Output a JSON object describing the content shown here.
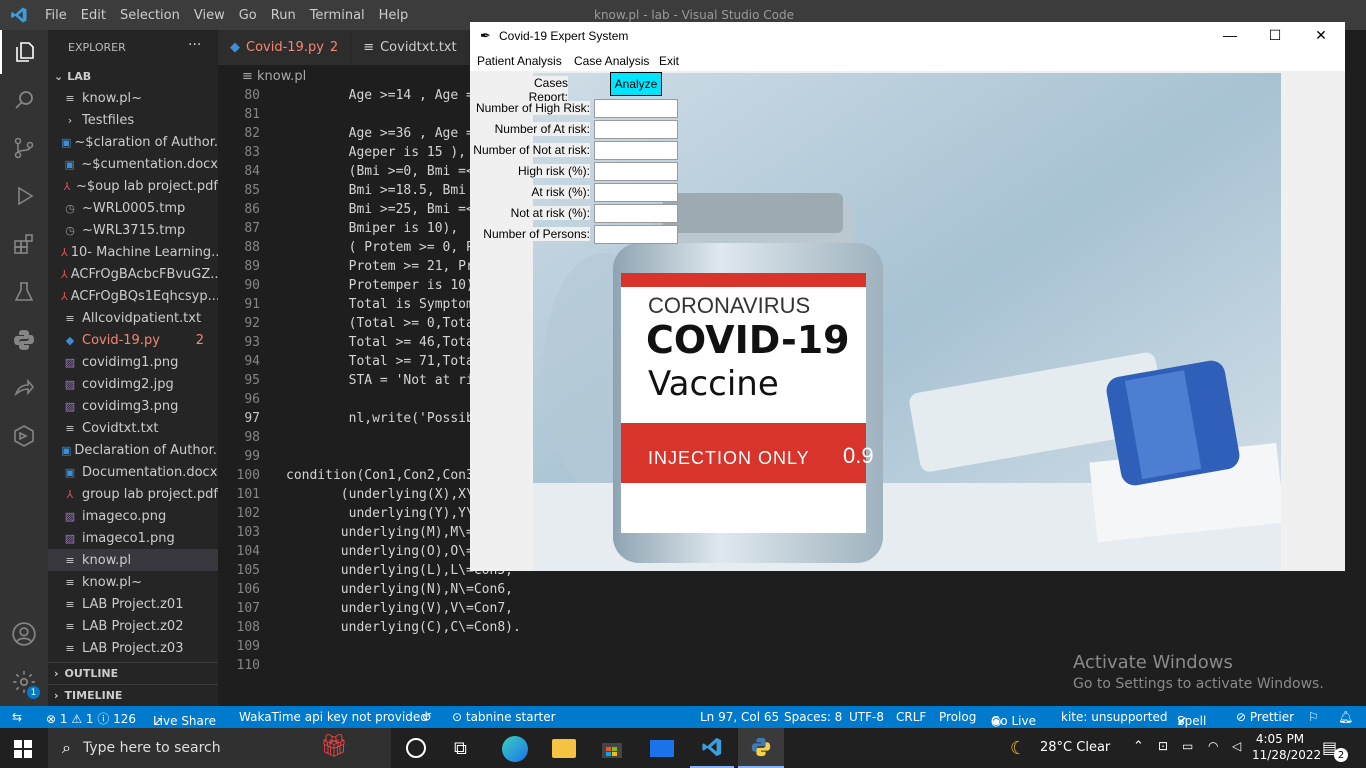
{
  "titlebar": {
    "menu": [
      "File",
      "Edit",
      "Selection",
      "View",
      "Go",
      "Run",
      "Terminal",
      "Help"
    ],
    "window_title": "know.pl - lab - Visual Studio Code"
  },
  "explorer": {
    "header": "EXPLORER",
    "more": "···",
    "folder": "LAB",
    "files": [
      {
        "name": "know.pl~",
        "icon": "≡",
        "color": "#cccccc",
        "badge": ""
      },
      {
        "name": "Testfiles",
        "icon": "›",
        "color": "#cccccc",
        "badge": ""
      },
      {
        "name": "~$claration of Author...",
        "icon": "▣",
        "color": "#3c8fd6",
        "badge": ""
      },
      {
        "name": "~$cumentation.docx",
        "icon": "▣",
        "color": "#3c8fd6",
        "badge": ""
      },
      {
        "name": "~$oup lab project.pdf",
        "icon": "⅄",
        "color": "#e05050",
        "badge": ""
      },
      {
        "name": "~WRL0005.tmp",
        "icon": "◷",
        "color": "#999999",
        "badge": ""
      },
      {
        "name": "~WRL3715.tmp",
        "icon": "◷",
        "color": "#999999",
        "badge": ""
      },
      {
        "name": "10- Machine Learning...",
        "icon": "⅄",
        "color": "#e05050",
        "badge": ""
      },
      {
        "name": "ACFrOgBAcbcFBvuGZ...",
        "icon": "⅄",
        "color": "#e05050",
        "badge": ""
      },
      {
        "name": "ACFrOgBQs1Eqhcsyp...",
        "icon": "⅄",
        "color": "#e05050",
        "badge": ""
      },
      {
        "name": "Allcovidpatient.txt",
        "icon": "≡",
        "color": "#cccccc",
        "badge": ""
      },
      {
        "name": "Covid-19.py",
        "icon": "◆",
        "color": "#3c8fd6",
        "badge": "2",
        "error": true
      },
      {
        "name": "covidimg1.png",
        "icon": "▨",
        "color": "#a074c4",
        "badge": ""
      },
      {
        "name": "covidimg2.jpg",
        "icon": "▨",
        "color": "#a074c4",
        "badge": ""
      },
      {
        "name": "covidimg3.png",
        "icon": "▨",
        "color": "#a074c4",
        "badge": ""
      },
      {
        "name": "Covidtxt.txt",
        "icon": "≡",
        "color": "#cccccc",
        "badge": ""
      },
      {
        "name": "Declaration of Author...",
        "icon": "▣",
        "color": "#3c8fd6",
        "badge": ""
      },
      {
        "name": "Documentation.docx",
        "icon": "▣",
        "color": "#3c8fd6",
        "badge": ""
      },
      {
        "name": "group lab project.pdf",
        "icon": "⅄",
        "color": "#e05050",
        "badge": ""
      },
      {
        "name": "imageco.png",
        "icon": "▨",
        "color": "#a074c4",
        "badge": ""
      },
      {
        "name": "imageco1.png",
        "icon": "▨",
        "color": "#a074c4",
        "badge": ""
      },
      {
        "name": "know.pl",
        "icon": "≡",
        "color": "#cccccc",
        "badge": "",
        "selected": true
      },
      {
        "name": "know.pl~",
        "icon": "≡",
        "color": "#cccccc",
        "badge": ""
      },
      {
        "name": "LAB Project.z01",
        "icon": "≡",
        "color": "#cccccc",
        "badge": ""
      },
      {
        "name": "LAB Project.z02",
        "icon": "≡",
        "color": "#cccccc",
        "badge": ""
      },
      {
        "name": "LAB Project.z03",
        "icon": "≡",
        "color": "#cccccc",
        "badge": ""
      }
    ],
    "outline": "OUTLINE",
    "timeline": "TIMELINE"
  },
  "tabs": [
    {
      "label": "Covid-19.py",
      "badge": "2",
      "icon": "◆"
    },
    {
      "label": "Covidtxt.txt",
      "badge": "",
      "icon": "≡"
    }
  ],
  "breadcrumb": "≡ know.pl",
  "code": [
    {
      "n": "80",
      "t": "        Age >=14 , Age ="
    },
    {
      "n": "81",
      "t": ""
    },
    {
      "n": "82",
      "t": "        Age >=36 , Age ="
    },
    {
      "n": "83",
      "t": "        Ageper is 15 ),"
    },
    {
      "n": "84",
      "t": "        (Bmi >=0, Bmi =<"
    },
    {
      "n": "85",
      "t": "        Bmi >=18.5, Bmi"
    },
    {
      "n": "86",
      "t": "        Bmi >=25, Bmi =<"
    },
    {
      "n": "87",
      "t": "        Bmiper is 10),"
    },
    {
      "n": "88",
      "t": "        ( Protem >= 0, P"
    },
    {
      "n": "89",
      "t": "        Protem >= 21, Pr"
    },
    {
      "n": "90",
      "t": "        Protemper is 10)"
    },
    {
      "n": "91",
      "t": "        Total is Symptom"
    },
    {
      "n": "92",
      "t": "        (Total >= 0,Tota"
    },
    {
      "n": "93",
      "t": "        Total >= 46,Tota"
    },
    {
      "n": "94",
      "t": "        Total >= 71,Tota"
    },
    {
      "n": "95",
      "t": "        STA = 'Not at ri"
    },
    {
      "n": "96",
      "t": ""
    },
    {
      "n": "97",
      "t": "        nl,write('Possib"
    },
    {
      "n": "98",
      "t": ""
    },
    {
      "n": "99",
      "t": ""
    },
    {
      "n": "100",
      "t": "condition(Con1,Con2,Con3"
    },
    {
      "n": "101",
      "t": "       (underlying(X),X\\"
    },
    {
      "n": "102",
      "t": "        underlying(Y),Y\\"
    },
    {
      "n": "103",
      "t": "       underlying(M),M\\="
    },
    {
      "n": "104",
      "t": "       underlying(O),O\\="
    },
    {
      "n": "105",
      "t": "       underlying(L),L\\=Con5,"
    },
    {
      "n": "106",
      "t": "       underlying(N),N\\=Con6,"
    },
    {
      "n": "107",
      "t": "       underlying(V),V\\=Con7,"
    },
    {
      "n": "108",
      "t": "       underlying(C),C\\=Con8)."
    },
    {
      "n": "109",
      "t": ""
    },
    {
      "n": "110",
      "t": ""
    }
  ],
  "statusbar": {
    "remote": "⇆",
    "problems": "⊗ 1 ⚠ 1 ⓘ 126",
    "live_share": "Live Share",
    "wakatime": "WakaTime api key not provided",
    "history": "↺",
    "tabnine": "⊙ tabnine starter",
    "position": "Ln 97, Col 65",
    "spaces": "Spaces: 8",
    "encoding": "UTF-8",
    "eol": "CRLF",
    "language": "Prolog",
    "go_live": "Go Live",
    "kite": "kite: unsupported",
    "spell": "Spell",
    "prettier": "⊘ Prettier"
  },
  "activate": {
    "title": "Activate Windows",
    "subtitle": "Go to Settings to activate Windows."
  },
  "taskbar": {
    "search_placeholder": "Type here to search",
    "weather": "28°C  Clear",
    "time": "4:05 PM",
    "date": "11/28/2022",
    "notifications": "2"
  },
  "app": {
    "title": "Covid-19 Expert System",
    "menu": [
      "Patient Analysis",
      "Case Analysis",
      "Exit"
    ],
    "cases_report_label": "Cases Report:",
    "analyze_button": "Analyze",
    "fields": [
      {
        "label": "Number of High Risk:",
        "value": ""
      },
      {
        "label": "Number of At risk:",
        "value": ""
      },
      {
        "label": "Number of Not at risk:",
        "value": ""
      },
      {
        "label": "High risk (%):",
        "value": ""
      },
      {
        "label": "At risk (%):",
        "value": ""
      },
      {
        "label": "Not at risk (%):",
        "value": ""
      },
      {
        "label": "Number of Persons:",
        "value": ""
      }
    ],
    "vial": {
      "line1": "CORONAVIRUS",
      "line2": "COVID-19",
      "line3": "Vaccine",
      "band": "INJECTION ONLY",
      "dose": "0.9"
    },
    "analyze_color": "#00e5ff"
  }
}
